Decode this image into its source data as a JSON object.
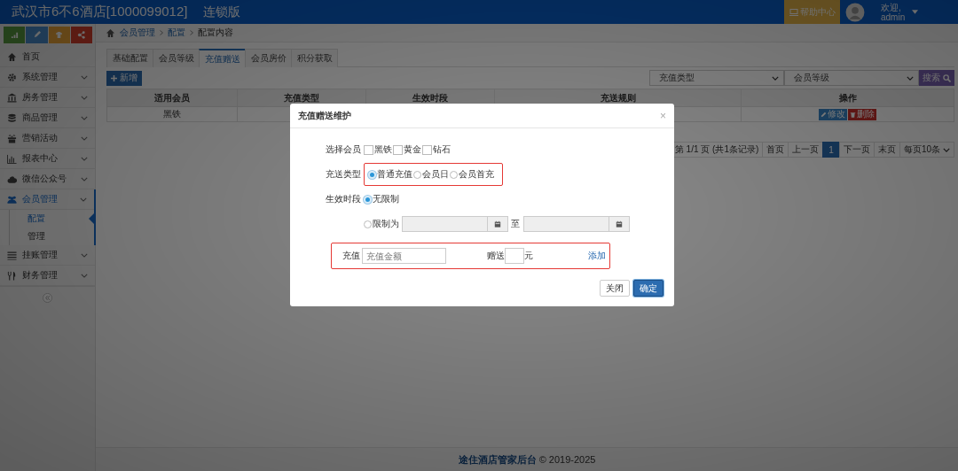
{
  "header": {
    "title": "武汉市6不6酒店[1000099012]",
    "edition": "连锁版",
    "help_button": "帮助中心",
    "user": {
      "greeting": "欢迎,",
      "name": "admin"
    }
  },
  "sidebar": {
    "items": [
      {
        "label": "首页",
        "kind": "link",
        "selected": false
      },
      {
        "label": "系统管理",
        "kind": "menu",
        "selected": false
      },
      {
        "label": "房务管理",
        "kind": "menu",
        "selected": false
      },
      {
        "label": "商品管理",
        "kind": "menu",
        "selected": false
      },
      {
        "label": "营销活动",
        "kind": "menu",
        "selected": false
      },
      {
        "label": "报表中心",
        "kind": "menu",
        "selected": false
      },
      {
        "label": "微信公众号",
        "kind": "menu",
        "selected": false
      },
      {
        "label": "会员管理",
        "kind": "menu",
        "selected": true,
        "children": [
          {
            "label": "配置",
            "selected": true
          },
          {
            "label": "管理",
            "selected": false
          }
        ]
      },
      {
        "label": "挂账管理",
        "kind": "menu",
        "selected": false
      },
      {
        "label": "财务管理",
        "kind": "menu",
        "selected": false
      }
    ]
  },
  "breadcrumb": [
    "会员管理",
    "配置",
    "配置内容"
  ],
  "tabs": [
    {
      "label": "基础配置",
      "selected": false
    },
    {
      "label": "会员等级",
      "selected": false
    },
    {
      "label": "充值赠送",
      "selected": true
    },
    {
      "label": "会员房价",
      "selected": false
    },
    {
      "label": "积分获取",
      "selected": false
    }
  ],
  "add_button": "新增",
  "filters": [
    {
      "placeholder": "充值类型"
    },
    {
      "placeholder": "会员等级"
    }
  ],
  "search_button": "搜索",
  "table": {
    "columns": [
      "适用会员",
      "充值类型",
      "生效时段",
      "充送规则",
      "操作"
    ],
    "rows": [
      {
        "member": "黑铁",
        "actions": [
          {
            "kind": "edit",
            "label": "修改"
          },
          {
            "kind": "delete",
            "label": "删除"
          }
        ]
      }
    ]
  },
  "pagination": {
    "info": "第 1/1 页 (共1条记录)",
    "first": "首页",
    "prev": "上一页",
    "pages": [
      {
        "label": "1",
        "selected": true
      }
    ],
    "next": "下一页",
    "last": "末页",
    "page_size": "每页10条"
  },
  "footer": {
    "link": "途住酒店管家后台",
    "text": "© 2019-2025"
  },
  "modal": {
    "title": "充值赠送维护",
    "close": "×",
    "member_label": "选择会员",
    "members": [
      {
        "label": "黑铁",
        "checked": false
      },
      {
        "label": "黄金",
        "checked": false
      },
      {
        "label": "钻石",
        "checked": false
      }
    ],
    "type_label": "充送类型",
    "types": [
      {
        "label": "普通充值",
        "selected": true
      },
      {
        "label": "会员日",
        "selected": false
      },
      {
        "label": "会员首充",
        "selected": false
      }
    ],
    "period_label": "生效时段",
    "period_unlimited": {
      "label": "无限制",
      "selected": true
    },
    "period_limited": {
      "label": "限制为",
      "selected": false
    },
    "period_to": "至",
    "amount_label": "充值",
    "amount_placeholder": "充值金额",
    "bonus_label": "赠送",
    "bonus_unit": "元",
    "add_link": "添加",
    "buttons": [
      {
        "kind": "default",
        "label": "关闭"
      },
      {
        "kind": "primary",
        "label": "确定"
      }
    ]
  }
}
